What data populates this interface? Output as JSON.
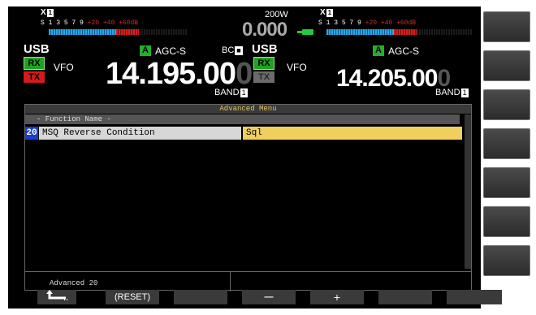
{
  "main": {
    "antenna": "1",
    "meter_scale_s": "S",
    "meter_scale_nums": "1  3  5  7  9",
    "meter_scale_red": "+20  +40 +60dB",
    "mode": "USB",
    "rx": "RX",
    "tx": "TX",
    "vfo": "VFO",
    "agc_a": "A",
    "agc": "AGC-S",
    "bc": "BC",
    "bc_box": "",
    "freq_main": "14.195.00",
    "freq_dim": "0",
    "band": "BAND",
    "band_box": "1"
  },
  "center": {
    "power": "200W",
    "tx_freq": "0.000"
  },
  "sub": {
    "antenna": "1",
    "meter_scale_s": "S",
    "meter_scale_nums": "1  3  5  7  9",
    "meter_scale_red": "+20  +40 +60dB",
    "mode": "USB",
    "rx": "RX",
    "tx": "TX",
    "vfo": "VFO",
    "agc_a": "A",
    "agc": "AGC-S",
    "freq_main": "14.205.00",
    "freq_dim": "0",
    "band": "BAND",
    "band_box": "1"
  },
  "menu": {
    "title": "Advanced Menu",
    "column_header": "- Function Name -",
    "items": [
      {
        "number": "20",
        "name": "MSQ Reverse Condition",
        "value": "Sql"
      }
    ],
    "footer": "Advanced 20"
  },
  "softkeys": {
    "back": "←",
    "reset": "(RESET)",
    "minus": "—",
    "plus": "+"
  },
  "colors": {
    "rx_green": "#1fa31f",
    "tx_red": "#d41a1a",
    "menu_highlight": "#f0cf5e",
    "menu_number": "#1a3ecc"
  }
}
